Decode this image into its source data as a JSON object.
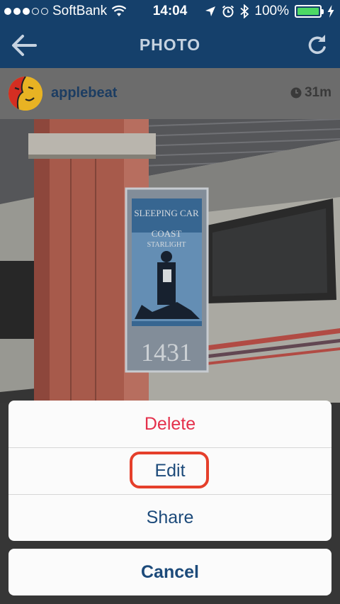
{
  "status_bar": {
    "carrier": "SoftBank",
    "time": "14:04",
    "battery_percent": "100%",
    "battery_level": 1.0,
    "icons": [
      "signal-dots-icon",
      "wifi-icon",
      "location-arrow-icon",
      "alarm-icon",
      "bluetooth-icon",
      "battery-icon",
      "charging-bolt-icon"
    ]
  },
  "nav": {
    "title": "PHOTO",
    "back_icon": "arrow-left-icon",
    "refresh_icon": "refresh-icon"
  },
  "post": {
    "username": "applebeat",
    "time_ago": "31m",
    "clock_icon": "clock-icon",
    "photo_sign": {
      "line1": "SLEEPING CAR",
      "line2": "COAST",
      "line3": "STARLIGHT",
      "number": "1431"
    }
  },
  "action_sheet": {
    "delete_label": "Delete",
    "edit_label": "Edit",
    "share_label": "Share",
    "cancel_label": "Cancel"
  },
  "colors": {
    "header_bg": "#15406b",
    "destructive": "#e4304b",
    "action": "#1c4a7a",
    "highlight": "#e53f2b",
    "battery": "#4cd964"
  }
}
